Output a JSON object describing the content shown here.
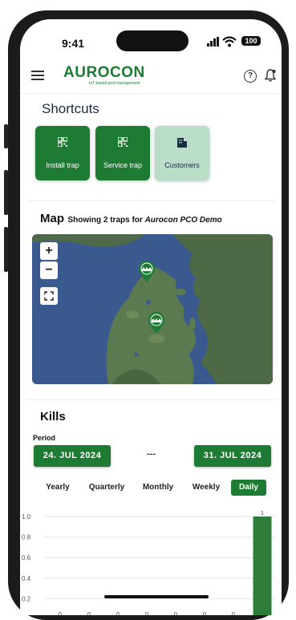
{
  "status_bar": {
    "time": "9:41",
    "battery": "100"
  },
  "app_bar": {
    "logo_text": "AUROCON",
    "logo_tagline": "IoT based pest management",
    "menu_icon": "hamburger-menu-icon",
    "help_icon": "help-circle-icon",
    "notification_icon": "bell-icon"
  },
  "shortcuts": {
    "title": "Shortcuts",
    "items": [
      {
        "label": "Install trap",
        "icon": "qr-code-icon",
        "style": "primary"
      },
      {
        "label": "Service trap",
        "icon": "qr-code-icon",
        "style": "primary"
      },
      {
        "label": "Customers",
        "icon": "building-icon",
        "style": "secondary"
      }
    ]
  },
  "map": {
    "title": "Map",
    "subtitle_prefix": "Showing 2 traps for ",
    "organization": "Aurocon PCO Demo",
    "zoom_in": "+",
    "zoom_out": "−",
    "fullscreen_icon": "fullscreen-icon",
    "marker_icon": "trap-marker-icon",
    "marker_count": 2
  },
  "kills": {
    "title": "Kills",
    "period_label": "Period",
    "start_date": "24. JUL 2024",
    "separator": "---",
    "end_date": "31. JUL 2024",
    "periods": [
      {
        "label": "Yearly",
        "active": false
      },
      {
        "label": "Quarterly",
        "active": false
      },
      {
        "label": "Monthly",
        "active": false
      },
      {
        "label": "Weekly",
        "active": false
      },
      {
        "label": "Daily",
        "active": true
      }
    ]
  },
  "chart_data": {
    "type": "bar",
    "categories": [
      "",
      "",
      "",
      "",
      "",
      "",
      "",
      ""
    ],
    "values": [
      0,
      0,
      0,
      0,
      0,
      0,
      0,
      1
    ],
    "data_labels": [
      "0",
      "0",
      "0",
      "0",
      "0",
      "0",
      "0",
      "1"
    ],
    "y_ticks": [
      "1.0",
      "0.8",
      "0.6",
      "0.4",
      "0.2"
    ],
    "ylim": [
      0,
      1
    ],
    "grid": true,
    "bar_color": "#2f7d3b"
  },
  "colors": {
    "brand_green": "#1e7b33",
    "tile_light": "#b9ddc6",
    "heading": "#1c2b44"
  }
}
